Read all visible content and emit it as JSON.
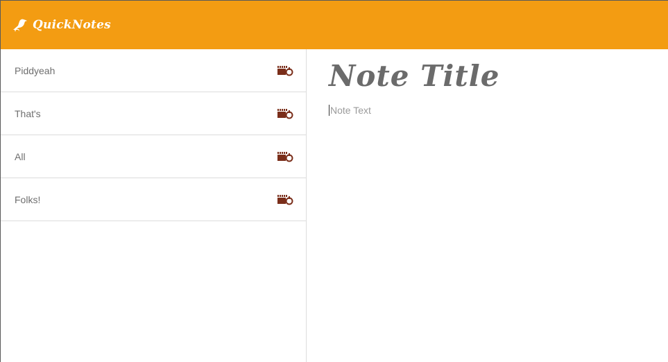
{
  "header": {
    "app_name": "QuickNotes",
    "logo_icon": "crow-icon",
    "background_color": "#f39c12"
  },
  "sidebar": {
    "notes": [
      {
        "label": "Piddyeah",
        "action_icon": "delete-note-icon"
      },
      {
        "label": "That's",
        "action_icon": "delete-note-icon"
      },
      {
        "label": "All",
        "action_icon": "delete-note-icon"
      },
      {
        "label": "Folks!",
        "action_icon": "delete-note-icon"
      }
    ],
    "icon_color": "#7a2e1a"
  },
  "editor": {
    "title_placeholder": "Note Title",
    "text_placeholder": "Note Text"
  }
}
